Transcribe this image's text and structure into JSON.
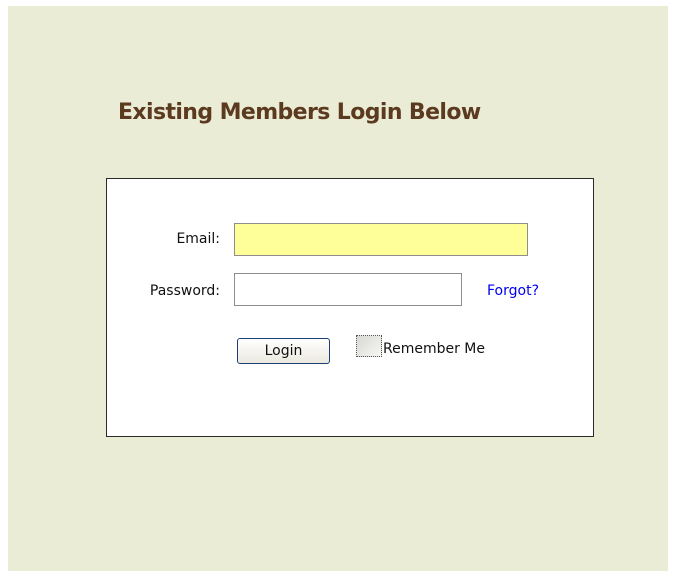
{
  "heading": "Existing Members Login Below",
  "form": {
    "email_label": "Email:",
    "email_value": "",
    "password_label": "Password:",
    "password_value": "",
    "forgot_link": "Forgot?",
    "login_button": "Login",
    "remember_label": "Remember Me",
    "remember_checked": false
  },
  "colors": {
    "background": "#ebecd6",
    "heading": "#5b3a1f",
    "email_field": "#ffff99",
    "link": "#0000ee"
  }
}
